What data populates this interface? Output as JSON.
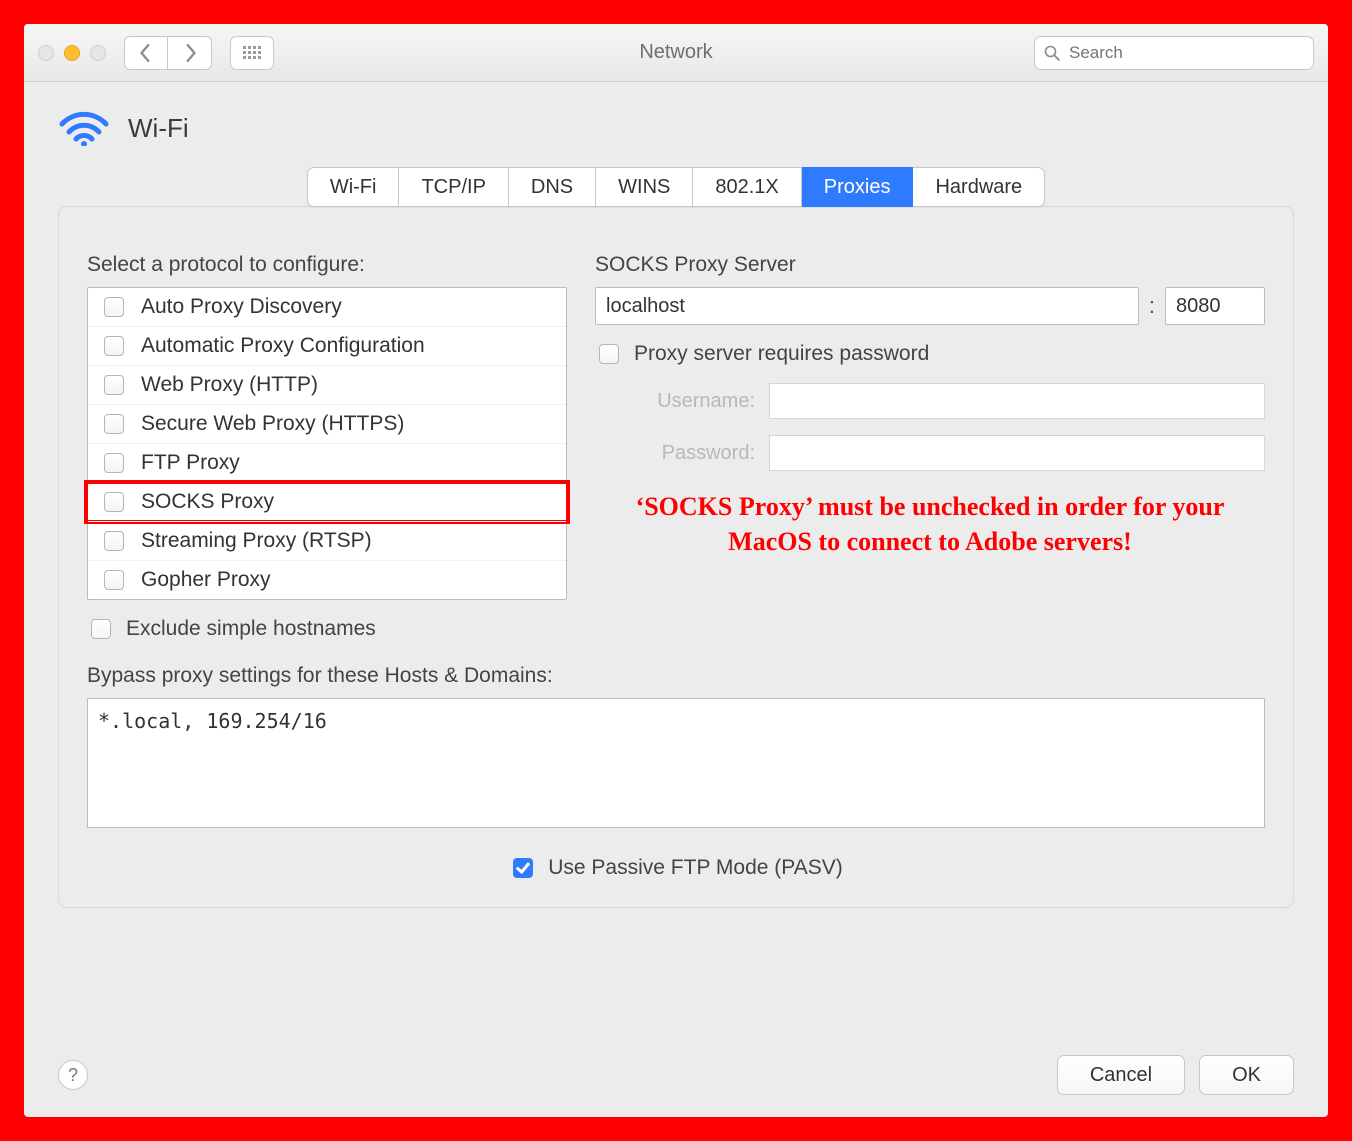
{
  "window": {
    "title": "Network",
    "search_placeholder": "Search"
  },
  "header": {
    "connection_name": "Wi-Fi"
  },
  "tabs": [
    {
      "label": "Wi-Fi",
      "active": false
    },
    {
      "label": "TCP/IP",
      "active": false
    },
    {
      "label": "DNS",
      "active": false
    },
    {
      "label": "WINS",
      "active": false
    },
    {
      "label": "802.1X",
      "active": false
    },
    {
      "label": "Proxies",
      "active": true
    },
    {
      "label": "Hardware",
      "active": false
    }
  ],
  "proxies": {
    "select_label": "Select a protocol to configure:",
    "protocols": [
      {
        "label": "Auto Proxy Discovery",
        "checked": false
      },
      {
        "label": "Automatic Proxy Configuration",
        "checked": false
      },
      {
        "label": "Web Proxy (HTTP)",
        "checked": false
      },
      {
        "label": "Secure Web Proxy (HTTPS)",
        "checked": false
      },
      {
        "label": "FTP Proxy",
        "checked": false
      },
      {
        "label": "SOCKS Proxy",
        "checked": false,
        "highlighted": true
      },
      {
        "label": "Streaming Proxy (RTSP)",
        "checked": false
      },
      {
        "label": "Gopher Proxy",
        "checked": false
      }
    ],
    "exclude_simple": {
      "label": "Exclude simple hostnames",
      "checked": false
    },
    "server_section_label": "SOCKS Proxy Server",
    "server_host": "localhost",
    "server_port": "8080",
    "requires_password": {
      "label": "Proxy server requires password",
      "checked": false
    },
    "username_label": "Username:",
    "username_value": "",
    "password_label": "Password:",
    "password_value": "",
    "bypass_label": "Bypass proxy settings for these Hosts & Domains:",
    "bypass_value": "*.local, 169.254/16",
    "pasv": {
      "label": "Use Passive FTP Mode (PASV)",
      "checked": true
    }
  },
  "annotation": "‘SOCKS Proxy’ must be unchecked in order for your MacOS to connect to Adobe servers!",
  "footer": {
    "cancel": "Cancel",
    "ok": "OK"
  }
}
